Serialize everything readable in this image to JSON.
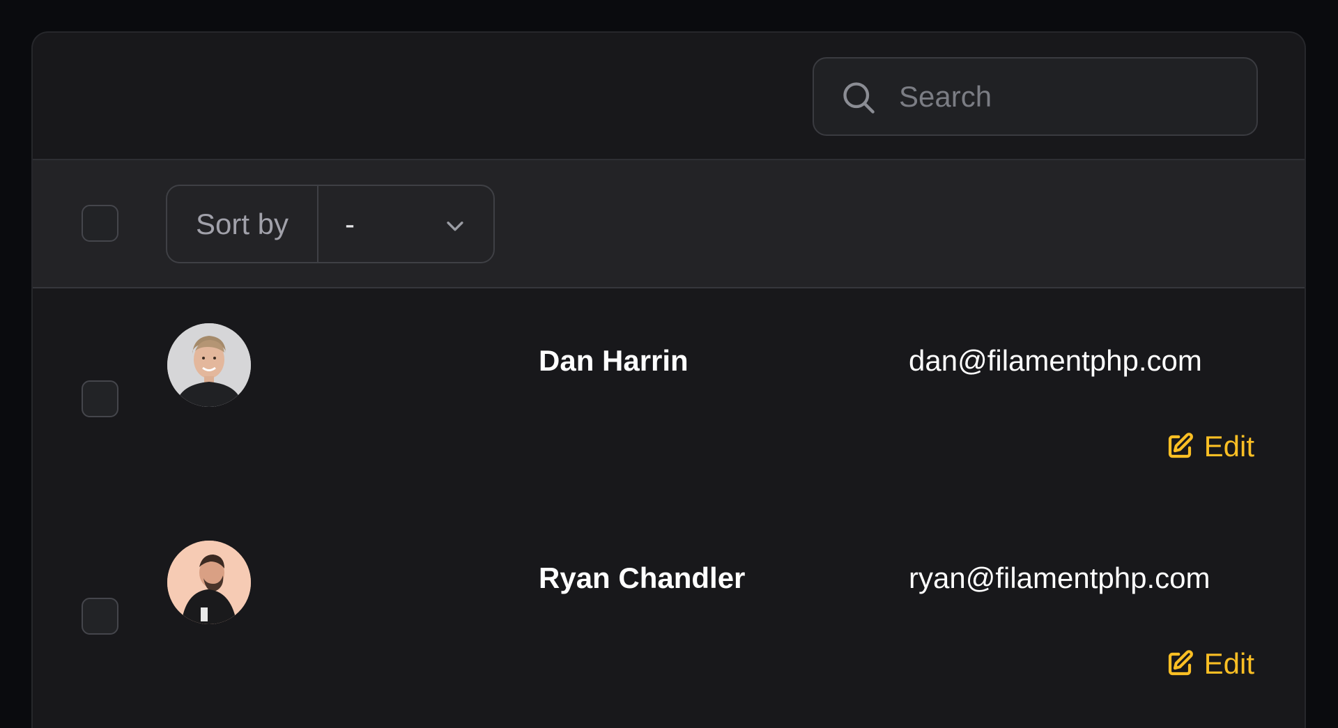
{
  "search": {
    "placeholder": "Search",
    "value": ""
  },
  "toolbar": {
    "sort_label": "Sort by",
    "sort_value": "-"
  },
  "rows": [
    {
      "name": "Dan Harrin",
      "email": "dan@filamentphp.com",
      "edit_label": "Edit",
      "avatar_bg": "#d9d9db"
    },
    {
      "name": "Ryan Chandler",
      "email": "ryan@filamentphp.com",
      "edit_label": "Edit",
      "avatar_bg": "#f4c7b0"
    }
  ],
  "colors": {
    "background": "#0a0b0e",
    "card": "#18181b",
    "toolbar": "#232326",
    "accent": "#fbbf24",
    "text": "#ffffff",
    "muted": "#a1a1aa"
  },
  "icons": [
    "search-icon",
    "chevron-down-icon",
    "edit-icon"
  ]
}
